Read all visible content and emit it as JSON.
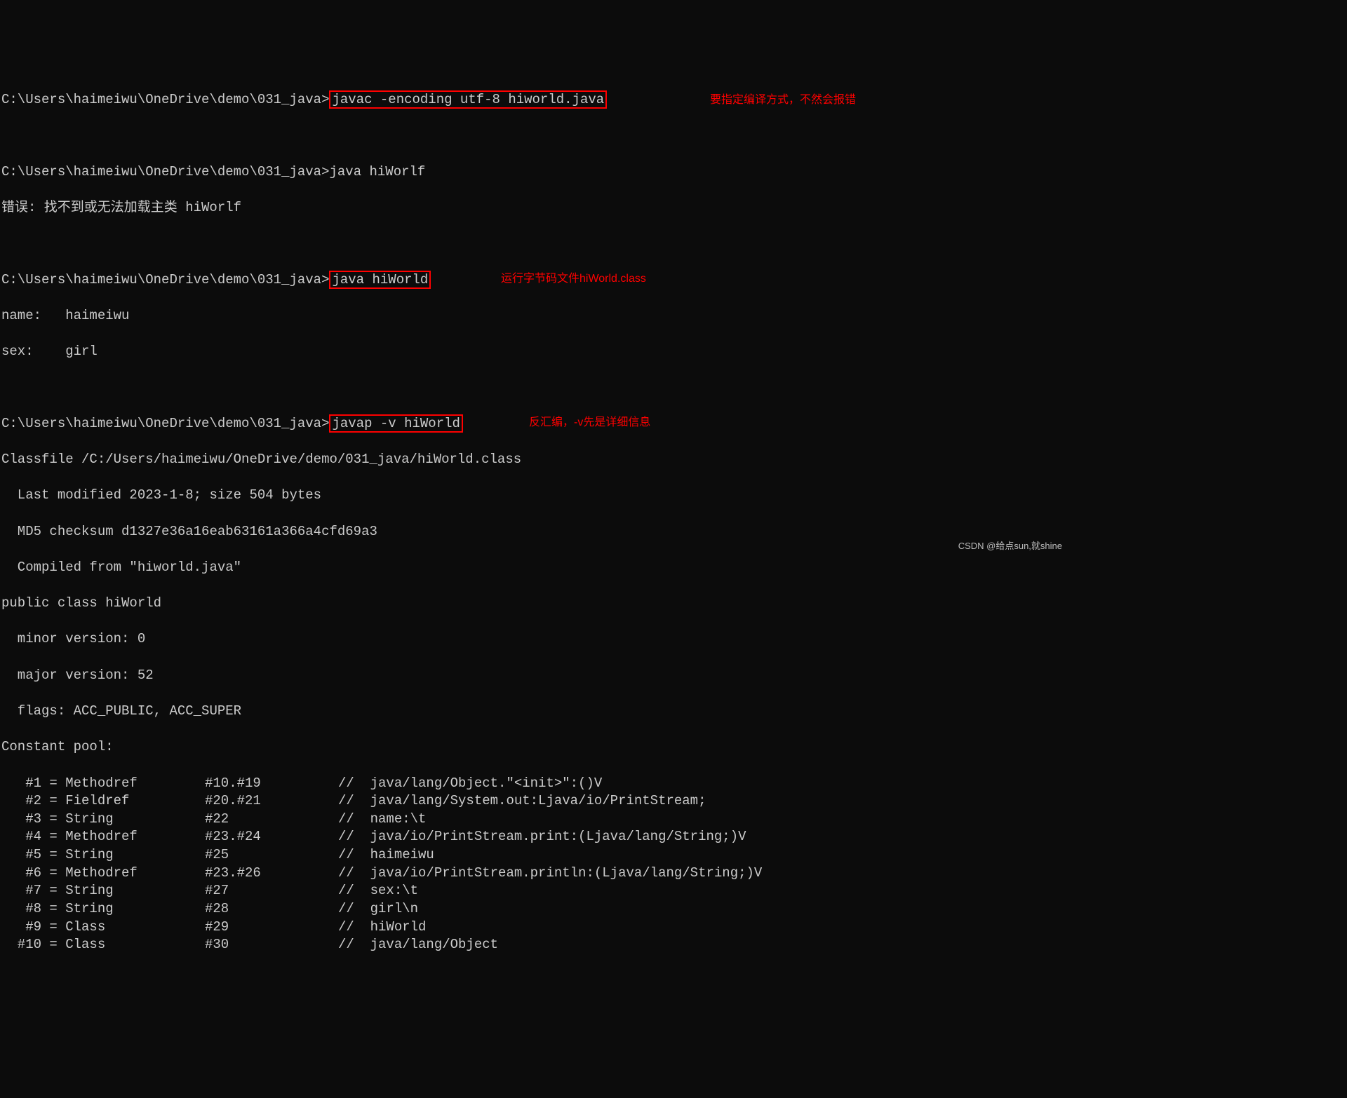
{
  "prompt": "C:\\Users\\haimeiwu\\OneDrive\\demo\\031_java>",
  "cmd1": "javac -encoding utf-8 hiworld.java",
  "note1": "要指定编译方式，不然会报错",
  "cmd2": "java hiWorlf",
  "err2": "错误: 找不到或无法加载主类 hiWorlf",
  "cmd3": "java hiWorld",
  "note3": "运行字节码文件hiWorld.class",
  "out3a": "name:   haimeiwu",
  "out3b": "sex:    girl",
  "cmd4": "javap -v hiWorld",
  "note4": "反汇编，-v先是详细信息",
  "classfile": "Classfile /C:/Users/haimeiwu/OneDrive/demo/031_java/hiWorld.class",
  "lastmod": "  Last modified 2023-1-8; size 504 bytes",
  "md5": "  MD5 checksum d1327e36a16eab63161a366a4cfd69a3",
  "compiled": "  Compiled from \"hiworld.java\"",
  "classdecl": "public class hiWorld",
  "minor": "  minor version: 0",
  "major": "  major version: 52",
  "flags": "  flags: ACC_PUBLIC, ACC_SUPER",
  "poolhdr": "Constant pool:",
  "pool": [
    {
      "a": "   #1 = Methodref",
      "b": "#10.#19",
      "c": "//  java/lang/Object.\"<init>\":()V"
    },
    {
      "a": "   #2 = Fieldref",
      "b": "#20.#21",
      "c": "//  java/lang/System.out:Ljava/io/PrintStream;"
    },
    {
      "a": "   #3 = String",
      "b": "#22",
      "c": "//  name:\\t"
    },
    {
      "a": "   #4 = Methodref",
      "b": "#23.#24",
      "c": "//  java/io/PrintStream.print:(Ljava/lang/String;)V"
    },
    {
      "a": "   #5 = String",
      "b": "#25",
      "c": "//  haimeiwu"
    },
    {
      "a": "   #6 = Methodref",
      "b": "#23.#26",
      "c": "//  java/io/PrintStream.println:(Ljava/lang/String;)V"
    },
    {
      "a": "   #7 = String",
      "b": "#27",
      "c": "//  sex:\\t"
    },
    {
      "a": "   #8 = String",
      "b": "#28",
      "c": "//  girl\\n"
    },
    {
      "a": "   #9 = Class",
      "b": "#29",
      "c": "//  hiWorld"
    },
    {
      "a": "  #10 = Class",
      "b": "#30",
      "c": "//  java/lang/Object"
    }
  ],
  "watermark": "CSDN @给点sun,就shine"
}
